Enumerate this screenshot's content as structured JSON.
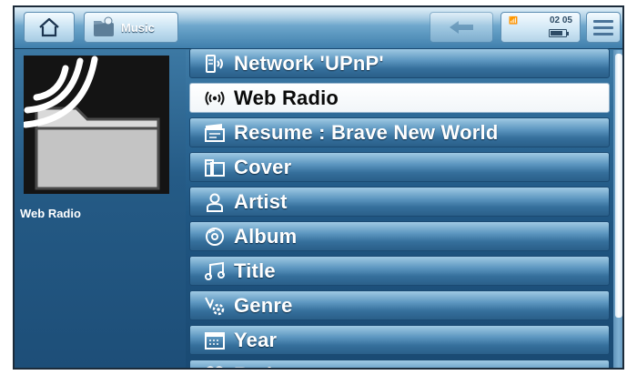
{
  "header": {
    "section_title": "Music",
    "home_icon": "home-icon",
    "music_icon": "music-folder-icon",
    "back_icon": "back-arrow-icon",
    "menu_icon": "menu-icon",
    "status": {
      "signal": "📶",
      "time": "02 05",
      "battery_level": 0.7
    }
  },
  "left_panel": {
    "thumbnail_icon": "web-radio-folder-icon",
    "label": "Web Radio"
  },
  "list": {
    "selected_index": 1,
    "items": [
      {
        "label": "Network 'UPnP'",
        "icon": "network-icon"
      },
      {
        "label": "Web Radio",
        "icon": "radio-waves-icon"
      },
      {
        "label": "Resume : Brave New World",
        "icon": "resume-icon"
      },
      {
        "label": "Cover",
        "icon": "cover-icon"
      },
      {
        "label": "Artist",
        "icon": "artist-icon"
      },
      {
        "label": "Album",
        "icon": "album-icon"
      },
      {
        "label": "Title",
        "icon": "music-note-icon"
      },
      {
        "label": "Genre",
        "icon": "genre-icon"
      },
      {
        "label": "Year",
        "icon": "calendar-icon"
      },
      {
        "label": "Rating",
        "icon": "rating-icon"
      }
    ]
  },
  "colors": {
    "accent": "#2e6a97",
    "selected_bg": "#ffffff",
    "item_text": "#ffffff"
  }
}
